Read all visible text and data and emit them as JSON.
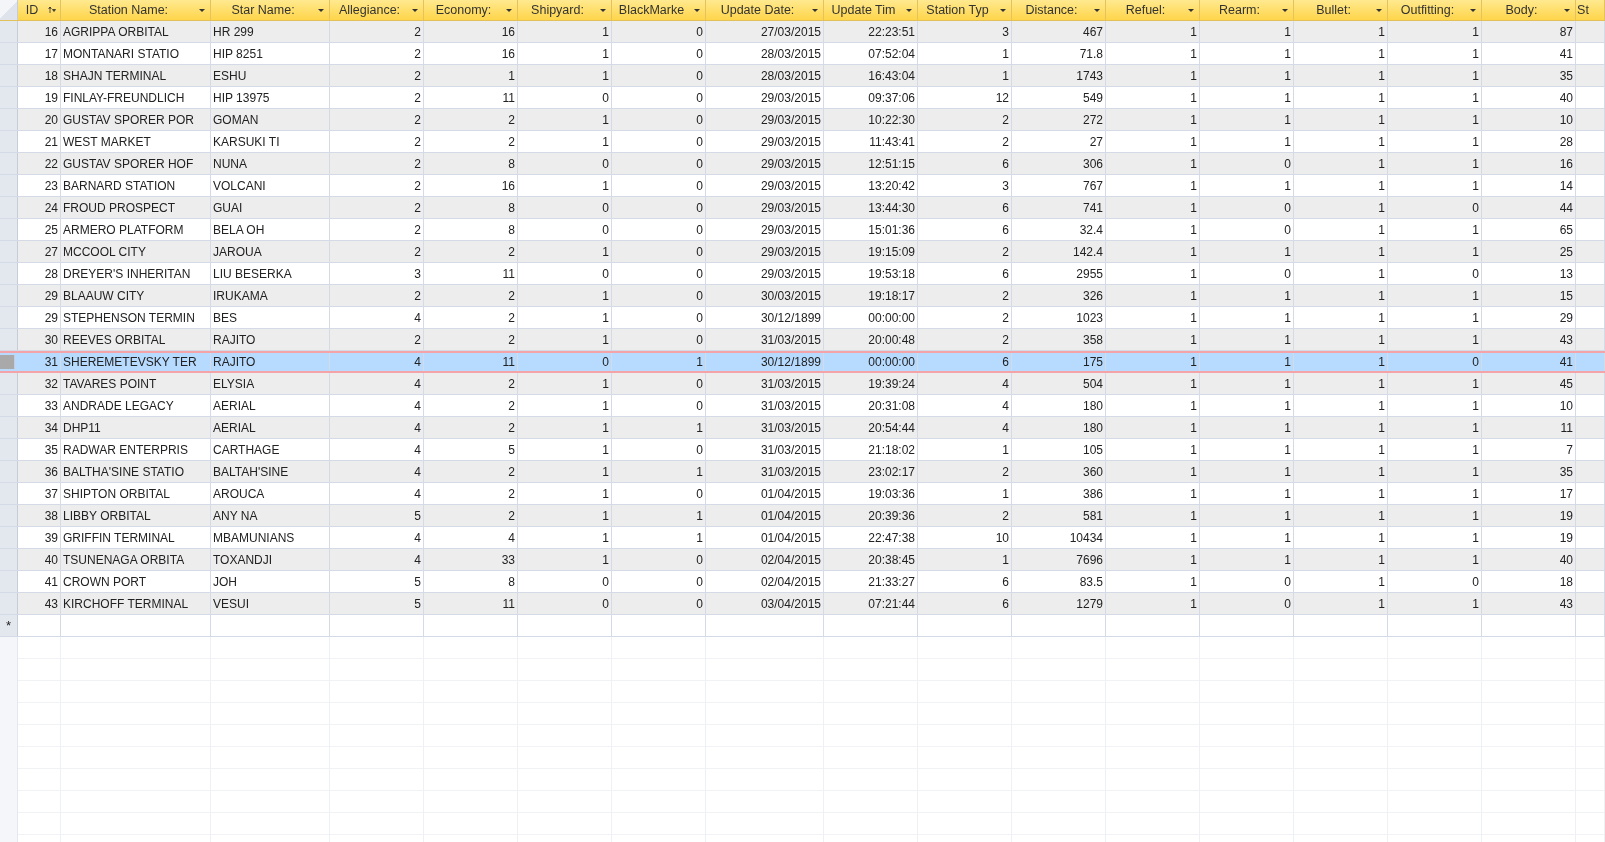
{
  "table": {
    "columns": [
      {
        "label": "ID",
        "kind": "number",
        "sorted": true
      },
      {
        "label": "Station Name:",
        "kind": "text",
        "sorted": false
      },
      {
        "label": "Star Name:",
        "kind": "text",
        "sorted": false
      },
      {
        "label": "Allegiance:",
        "kind": "number",
        "sorted": false
      },
      {
        "label": "Economy:",
        "kind": "number",
        "sorted": false
      },
      {
        "label": "Shipyard:",
        "kind": "number",
        "sorted": false
      },
      {
        "label": "BlackMarke",
        "kind": "number",
        "sorted": false
      },
      {
        "label": "Update Date:",
        "kind": "number",
        "sorted": false
      },
      {
        "label": "Update Tim",
        "kind": "number",
        "sorted": false
      },
      {
        "label": "Station Typ",
        "kind": "number",
        "sorted": false
      },
      {
        "label": "Distance:",
        "kind": "number",
        "sorted": false
      },
      {
        "label": "Refuel:",
        "kind": "number",
        "sorted": false
      },
      {
        "label": "Rearm:",
        "kind": "number",
        "sorted": false
      },
      {
        "label": "Bullet:",
        "kind": "number",
        "sorted": false
      },
      {
        "label": "Outfitting:",
        "kind": "number",
        "sorted": false
      },
      {
        "label": "Body:",
        "kind": "number",
        "sorted": false
      },
      {
        "label": "St"
      }
    ],
    "rows": [
      {
        "selected": false,
        "cells": [
          "16",
          "AGRIPPA ORBITAL",
          "HR 299",
          "2",
          "16",
          "1",
          "0",
          "27/03/2015",
          "22:23:51",
          "3",
          "467",
          "1",
          "1",
          "1",
          "1",
          "87"
        ]
      },
      {
        "selected": false,
        "cells": [
          "17",
          "MONTANARI STATIO",
          "HIP 8251",
          "2",
          "16",
          "1",
          "0",
          "28/03/2015",
          "07:52:04",
          "1",
          "71.8",
          "1",
          "1",
          "1",
          "1",
          "41"
        ]
      },
      {
        "selected": false,
        "cells": [
          "18",
          "SHAJN TERMINAL",
          "ESHU",
          "2",
          "1",
          "1",
          "0",
          "28/03/2015",
          "16:43:04",
          "1",
          "1743",
          "1",
          "1",
          "1",
          "1",
          "35"
        ]
      },
      {
        "selected": false,
        "cells": [
          "19",
          "FINLAY-FREUNDLICH",
          "HIP 13975",
          "2",
          "11",
          "0",
          "0",
          "29/03/2015",
          "09:37:06",
          "12",
          "549",
          "1",
          "1",
          "1",
          "1",
          "40"
        ]
      },
      {
        "selected": false,
        "cells": [
          "20",
          "GUSTAV SPORER POR",
          "GOMAN",
          "2",
          "2",
          "1",
          "0",
          "29/03/2015",
          "10:22:30",
          "2",
          "272",
          "1",
          "1",
          "1",
          "1",
          "10"
        ]
      },
      {
        "selected": false,
        "cells": [
          "21",
          "WEST MARKET",
          "KARSUKI TI",
          "2",
          "2",
          "1",
          "0",
          "29/03/2015",
          "11:43:41",
          "2",
          "27",
          "1",
          "1",
          "1",
          "1",
          "28"
        ]
      },
      {
        "selected": false,
        "cells": [
          "22",
          "GUSTAV SPORER HOF",
          "NUNA",
          "2",
          "8",
          "0",
          "0",
          "29/03/2015",
          "12:51:15",
          "6",
          "306",
          "1",
          "0",
          "1",
          "1",
          "16"
        ]
      },
      {
        "selected": false,
        "cells": [
          "23",
          "BARNARD STATION",
          "VOLCANI",
          "2",
          "16",
          "1",
          "0",
          "29/03/2015",
          "13:20:42",
          "3",
          "767",
          "1",
          "1",
          "1",
          "1",
          "14"
        ]
      },
      {
        "selected": false,
        "cells": [
          "24",
          "FROUD PROSPECT",
          "GUAI",
          "2",
          "8",
          "0",
          "0",
          "29/03/2015",
          "13:44:30",
          "6",
          "741",
          "1",
          "0",
          "1",
          "0",
          "44"
        ]
      },
      {
        "selected": false,
        "cells": [
          "25",
          "ARMERO PLATFORM",
          "BELA OH",
          "2",
          "8",
          "0",
          "0",
          "29/03/2015",
          "15:01:36",
          "6",
          "32.4",
          "1",
          "0",
          "1",
          "1",
          "65"
        ]
      },
      {
        "selected": false,
        "cells": [
          "27",
          "MCCOOL CITY",
          "JAROUA",
          "2",
          "2",
          "1",
          "0",
          "29/03/2015",
          "19:15:09",
          "2",
          "142.4",
          "1",
          "1",
          "1",
          "1",
          "25"
        ]
      },
      {
        "selected": false,
        "cells": [
          "28",
          "DREYER'S INHERITAN",
          "LIU BESERKA",
          "3",
          "11",
          "0",
          "0",
          "29/03/2015",
          "19:53:18",
          "6",
          "2955",
          "1",
          "0",
          "1",
          "0",
          "13"
        ]
      },
      {
        "selected": false,
        "cells": [
          "29",
          "BLAAUW CITY",
          "IRUKAMA",
          "2",
          "2",
          "1",
          "0",
          "30/03/2015",
          "19:18:17",
          "2",
          "326",
          "1",
          "1",
          "1",
          "1",
          "15"
        ]
      },
      {
        "selected": false,
        "cells": [
          "29",
          "STEPHENSON TERMIN",
          "BES",
          "4",
          "2",
          "1",
          "0",
          "30/12/1899",
          "00:00:00",
          "2",
          "1023",
          "1",
          "1",
          "1",
          "1",
          "29"
        ]
      },
      {
        "selected": false,
        "cells": [
          "30",
          "REEVES ORBITAL",
          "RAJITO",
          "2",
          "2",
          "1",
          "0",
          "31/03/2015",
          "20:00:48",
          "2",
          "358",
          "1",
          "1",
          "1",
          "1",
          "43"
        ]
      },
      {
        "selected": true,
        "cells": [
          "31",
          "SHEREMETEVSKY TER",
          "RAJITO",
          "4",
          "11",
          "0",
          "1",
          "30/12/1899",
          "00:00:00",
          "6",
          "175",
          "1",
          "1",
          "1",
          "0",
          "41"
        ]
      },
      {
        "selected": false,
        "cells": [
          "32",
          "TAVARES POINT",
          "ELYSIA",
          "4",
          "2",
          "1",
          "0",
          "31/03/2015",
          "19:39:24",
          "4",
          "504",
          "1",
          "1",
          "1",
          "1",
          "45"
        ]
      },
      {
        "selected": false,
        "cells": [
          "33",
          "ANDRADE LEGACY",
          "AERIAL",
          "4",
          "2",
          "1",
          "0",
          "31/03/2015",
          "20:31:08",
          "4",
          "180",
          "1",
          "1",
          "1",
          "1",
          "10"
        ]
      },
      {
        "selected": false,
        "cells": [
          "34",
          "DHP11",
          "AERIAL",
          "4",
          "2",
          "1",
          "1",
          "31/03/2015",
          "20:54:44",
          "4",
          "180",
          "1",
          "1",
          "1",
          "1",
          "11"
        ]
      },
      {
        "selected": false,
        "cells": [
          "35",
          "RADWAR ENTERPRIS",
          "CARTHAGE",
          "4",
          "5",
          "1",
          "0",
          "31/03/2015",
          "21:18:02",
          "1",
          "105",
          "1",
          "1",
          "1",
          "1",
          "7"
        ]
      },
      {
        "selected": false,
        "cells": [
          "36",
          "BALTHA'SINE STATIO",
          "BALTAH'SINE",
          "4",
          "2",
          "1",
          "1",
          "31/03/2015",
          "23:02:17",
          "2",
          "360",
          "1",
          "1",
          "1",
          "1",
          "35"
        ]
      },
      {
        "selected": false,
        "cells": [
          "37",
          "SHIPTON ORBITAL",
          "AROUCA",
          "4",
          "2",
          "1",
          "0",
          "01/04/2015",
          "19:03:36",
          "1",
          "386",
          "1",
          "1",
          "1",
          "1",
          "17"
        ]
      },
      {
        "selected": false,
        "cells": [
          "38",
          "LIBBY ORBITAL",
          "ANY NA",
          "5",
          "2",
          "1",
          "1",
          "01/04/2015",
          "20:39:36",
          "2",
          "581",
          "1",
          "1",
          "1",
          "1",
          "19"
        ]
      },
      {
        "selected": false,
        "cells": [
          "39",
          "GRIFFIN TERMINAL",
          "MBAMUNIANS",
          "4",
          "4",
          "1",
          "1",
          "01/04/2015",
          "22:47:38",
          "10",
          "10434",
          "1",
          "1",
          "1",
          "1",
          "19"
        ]
      },
      {
        "selected": false,
        "cells": [
          "40",
          "TSUNENAGA ORBITA",
          "TOXANDJI",
          "4",
          "33",
          "1",
          "0",
          "02/04/2015",
          "20:38:45",
          "1",
          "7696",
          "1",
          "1",
          "1",
          "1",
          "40"
        ]
      },
      {
        "selected": false,
        "cells": [
          "41",
          "CROWN PORT",
          "JOH",
          "5",
          "8",
          "0",
          "0",
          "02/04/2015",
          "21:33:27",
          "6",
          "83.5",
          "1",
          "0",
          "1",
          "0",
          "18"
        ]
      },
      {
        "selected": false,
        "cells": [
          "43",
          "KIRCHOFF TERMINAL",
          "VESUI",
          "5",
          "11",
          "0",
          "0",
          "03/04/2015",
          "07:21:44",
          "6",
          "1279",
          "1",
          "0",
          "1",
          "1",
          "43"
        ]
      }
    ],
    "new_row_marker": "*"
  }
}
